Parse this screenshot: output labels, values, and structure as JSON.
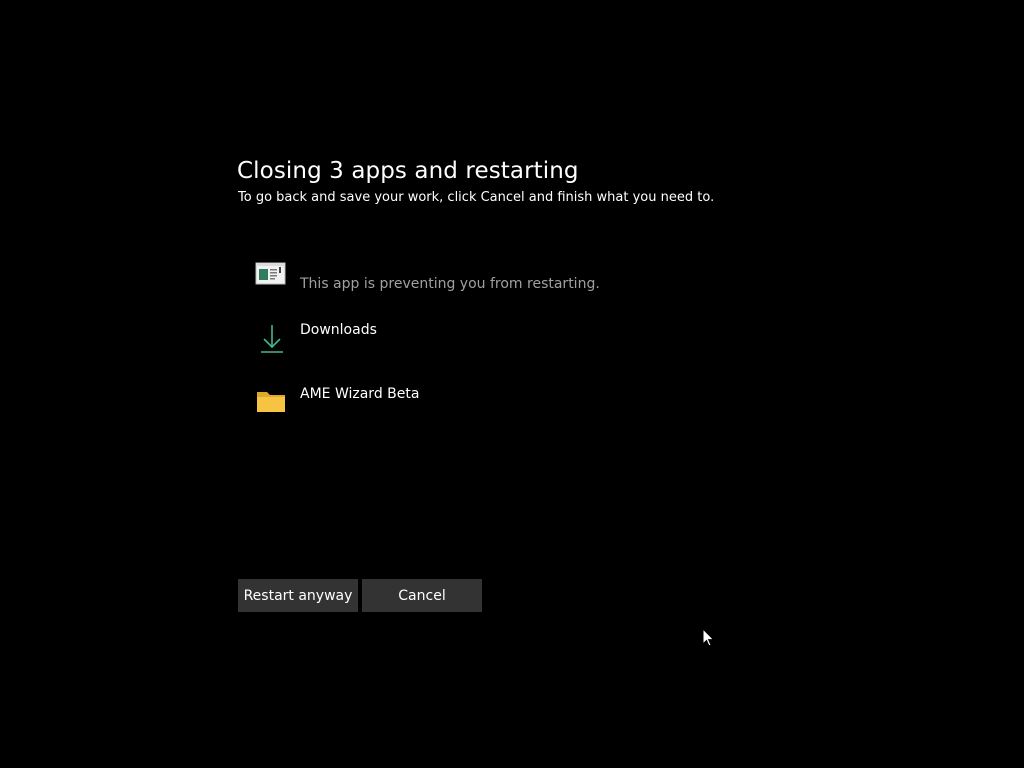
{
  "dialog": {
    "title": "Closing 3 apps and restarting",
    "subtitle": "To go back and save your work, click Cancel and finish what you need to."
  },
  "apps": [
    {
      "name": "",
      "note": "This app is preventing you from restarting.",
      "icon": "app-window-icon"
    },
    {
      "name": "Downloads",
      "note": "",
      "icon": "download-arrow-icon"
    },
    {
      "name": "AME Wizard Beta",
      "note": "",
      "icon": "folder-icon"
    }
  ],
  "buttons": {
    "restart_label": "Restart anyway",
    "cancel_label": "Cancel"
  },
  "colors": {
    "background": "#000000",
    "button": "#333333",
    "note_text": "#a0a0a0",
    "download_accent": "#3fb98e",
    "folder": "#f6c343"
  }
}
